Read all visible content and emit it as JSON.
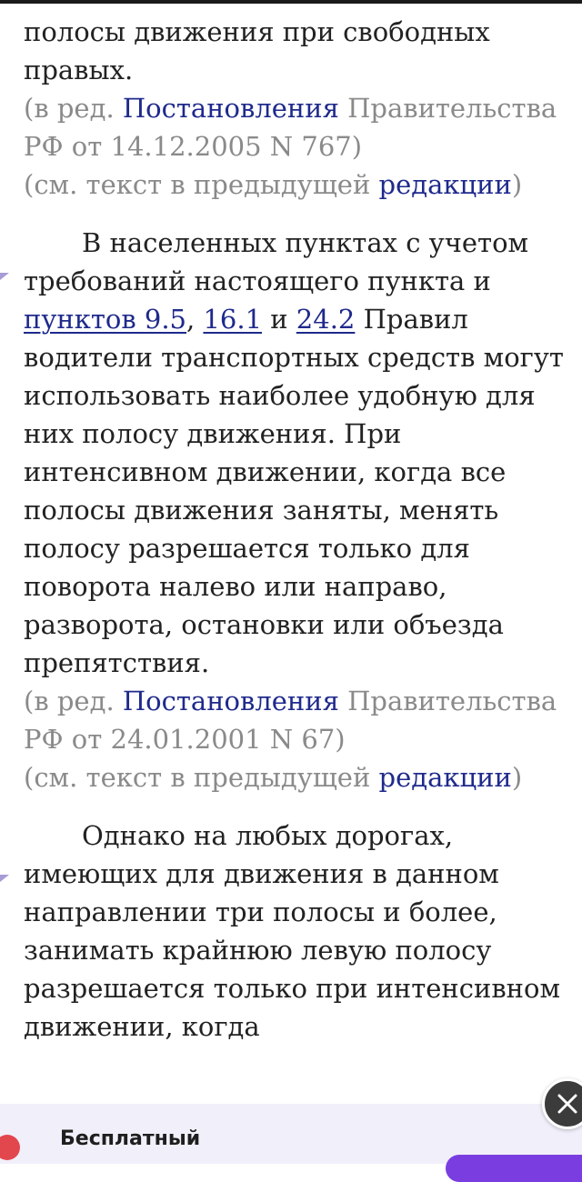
{
  "para1": {
    "text": "полосы движения при свободных правых."
  },
  "note1": {
    "prefix": "(в ред. ",
    "link": "Постановления",
    "rest": " Правительства РФ от 14.12.2005 N 767)"
  },
  "note2": {
    "prefix": "(см. текст в предыдущей ",
    "link": "редакции",
    "suffix": ")"
  },
  "para2": {
    "part1": "В населенных пунктах с учетом требований настоящего пункта и ",
    "link1": "пунктов 9.5",
    "sep1": ", ",
    "link2": "16.1",
    "sep2": " и ",
    "link3": "24.2",
    "part2": " Правил водители транспортных средств могут использовать наиболее удобную для них полосу движения. При интенсивном движении, когда все полосы движения заняты, менять полосу разрешается только для поворота налево или направо, разворота, остановки или объезда препятствия."
  },
  "note3": {
    "prefix": "(в ред. ",
    "link": "Постановления",
    "rest": " Правительства РФ от 24.01.2001 N 67)"
  },
  "note4": {
    "prefix": "(см. текст в предыдущей ",
    "link": "редакции",
    "suffix": ")"
  },
  "para3": {
    "text": "Однако на любых дорогах, имеющих для движения в данном направлении три полосы и более, занимать крайнюю левую полосу разрешается только при интенсивном движении, когда"
  },
  "banner": {
    "text": "Бесплатный"
  },
  "colors": {
    "link": "#1f2a8c",
    "note": "#8a8a8a",
    "text": "#222222",
    "banner_bg": "#f1effa",
    "marker": "#a89bd6"
  },
  "icons": {
    "close": "close-icon",
    "marker": "paragraph-marker-icon"
  }
}
